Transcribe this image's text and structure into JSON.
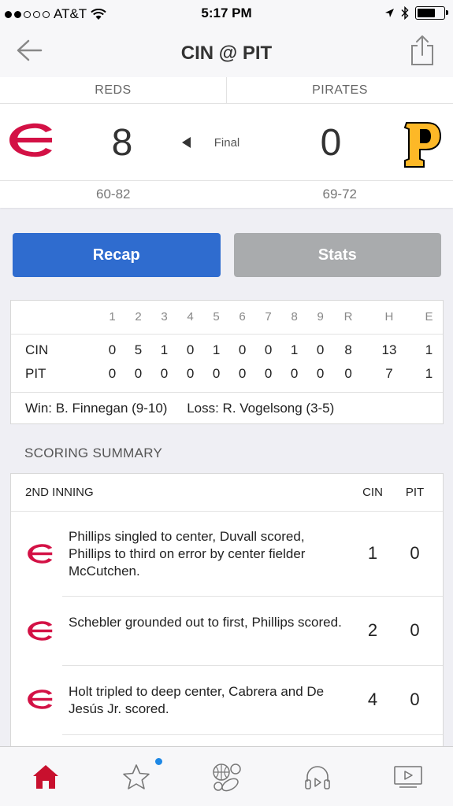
{
  "status_bar": {
    "carrier": "AT&T",
    "time": "5:17 PM",
    "signal_bars": 2,
    "signal_total": 5,
    "battery_level": 0.7
  },
  "nav": {
    "title": "CIN @ PIT",
    "back_icon": "back-arrow-icon",
    "share_icon": "share-icon"
  },
  "game": {
    "away": {
      "name": "REDS",
      "abbr": "CIN",
      "score": "8",
      "record": "60-82",
      "logo_color": "#d31145"
    },
    "home": {
      "name": "PIRATES",
      "abbr": "PIT",
      "score": "0",
      "record": "69-72",
      "logo_color": "#fdb827"
    },
    "status": "Final"
  },
  "buttons": {
    "recap": "Recap",
    "stats": "Stats"
  },
  "linescore": {
    "headers": [
      "1",
      "2",
      "3",
      "4",
      "5",
      "6",
      "7",
      "8",
      "9",
      "R",
      "H",
      "E"
    ],
    "rows": [
      {
        "team": "CIN",
        "values": [
          "0",
          "5",
          "1",
          "0",
          "1",
          "0",
          "0",
          "1",
          "0",
          "8",
          "13",
          "1"
        ]
      },
      {
        "team": "PIT",
        "values": [
          "0",
          "0",
          "0",
          "0",
          "0",
          "0",
          "0",
          "0",
          "0",
          "0",
          "7",
          "1"
        ]
      }
    ],
    "win": "Win: B. Finnegan (9-10)",
    "loss": "Loss: R. Vogelsong (3-5)"
  },
  "scoring_summary": {
    "title": "SCORING SUMMARY",
    "inning": "2ND INNING",
    "col1": "CIN",
    "col2": "PIT",
    "plays": [
      {
        "description": "Phillips singled to center, Duvall scored, Phillips to third on error by center fielder McCutchen.",
        "cin": "1",
        "pit": "0"
      },
      {
        "description": "Schebler grounded out to first, Phillips scored.",
        "cin": "2",
        "pit": "0"
      },
      {
        "description": "Holt tripled to deep center, Cabrera and De Jesús Jr. scored.",
        "cin": "4",
        "pit": "0"
      }
    ]
  },
  "tab_bar": {
    "tabs": [
      "home-icon",
      "star-icon",
      "sports-balls-icon",
      "headphones-icon",
      "video-icon"
    ],
    "active": "home-icon",
    "active_color": "#c8102e",
    "badge_color": "#1e88e5"
  }
}
